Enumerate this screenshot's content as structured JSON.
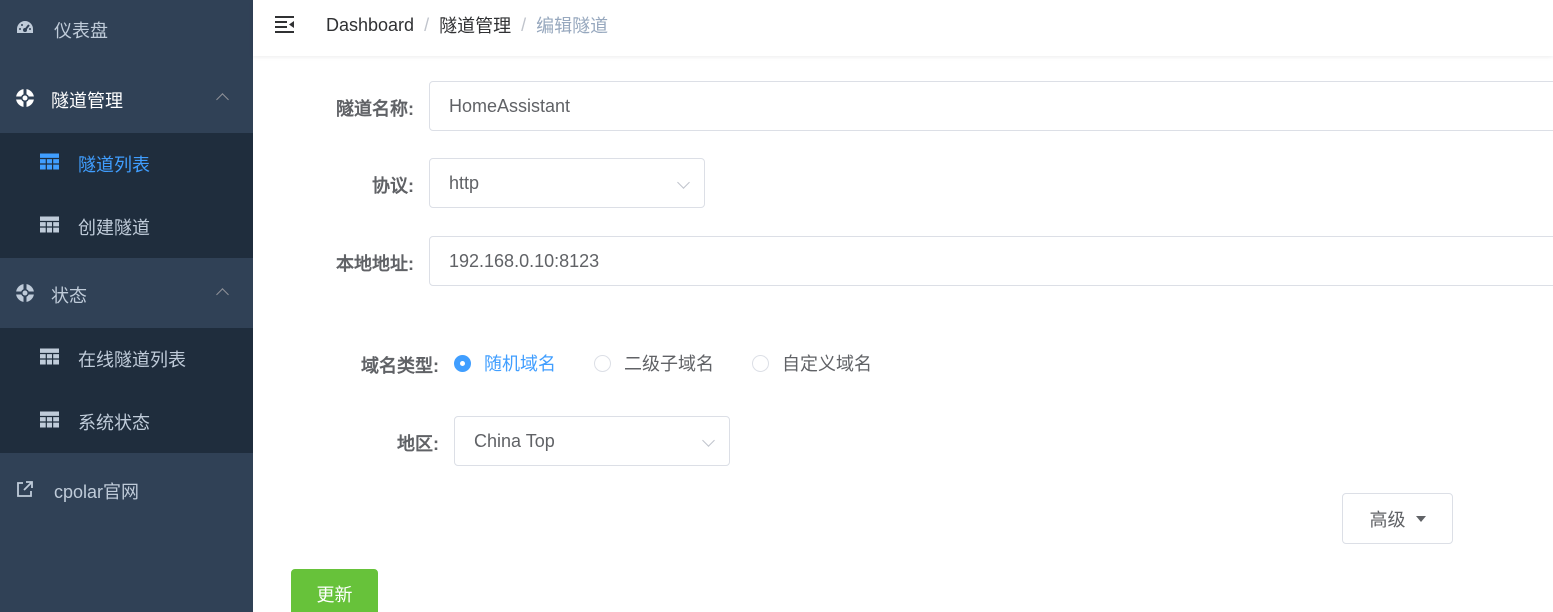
{
  "sidebar": {
    "dashboard": "仪表盘",
    "tunnel_mgmt": "隧道管理",
    "tunnel_list": "隧道列表",
    "create_tunnel": "创建隧道",
    "status": "状态",
    "online_tunnels": "在线隧道列表",
    "system_status": "系统状态",
    "website": "cpolar官网"
  },
  "breadcrumb": {
    "home": "Dashboard",
    "section": "隧道管理",
    "current": "编辑隧道",
    "separator": "/"
  },
  "form": {
    "name_label": "隧道名称:",
    "name_value": "HomeAssistant",
    "protocol_label": "协议:",
    "protocol_value": "http",
    "local_label": "本地地址:",
    "local_value": "192.168.0.10:8123",
    "domain_type_label": "域名类型:",
    "domain_options": [
      "随机域名",
      "二级子域名",
      "自定义域名"
    ],
    "domain_selected": "随机域名",
    "region_label": "地区:",
    "region_value": "China Top",
    "advanced_label": "高级",
    "update_label": "更新"
  },
  "colors": {
    "sidebar_bg": "#304156",
    "submenu_bg": "#1f2d3d",
    "active": "#409eff",
    "success": "#67c23a"
  }
}
